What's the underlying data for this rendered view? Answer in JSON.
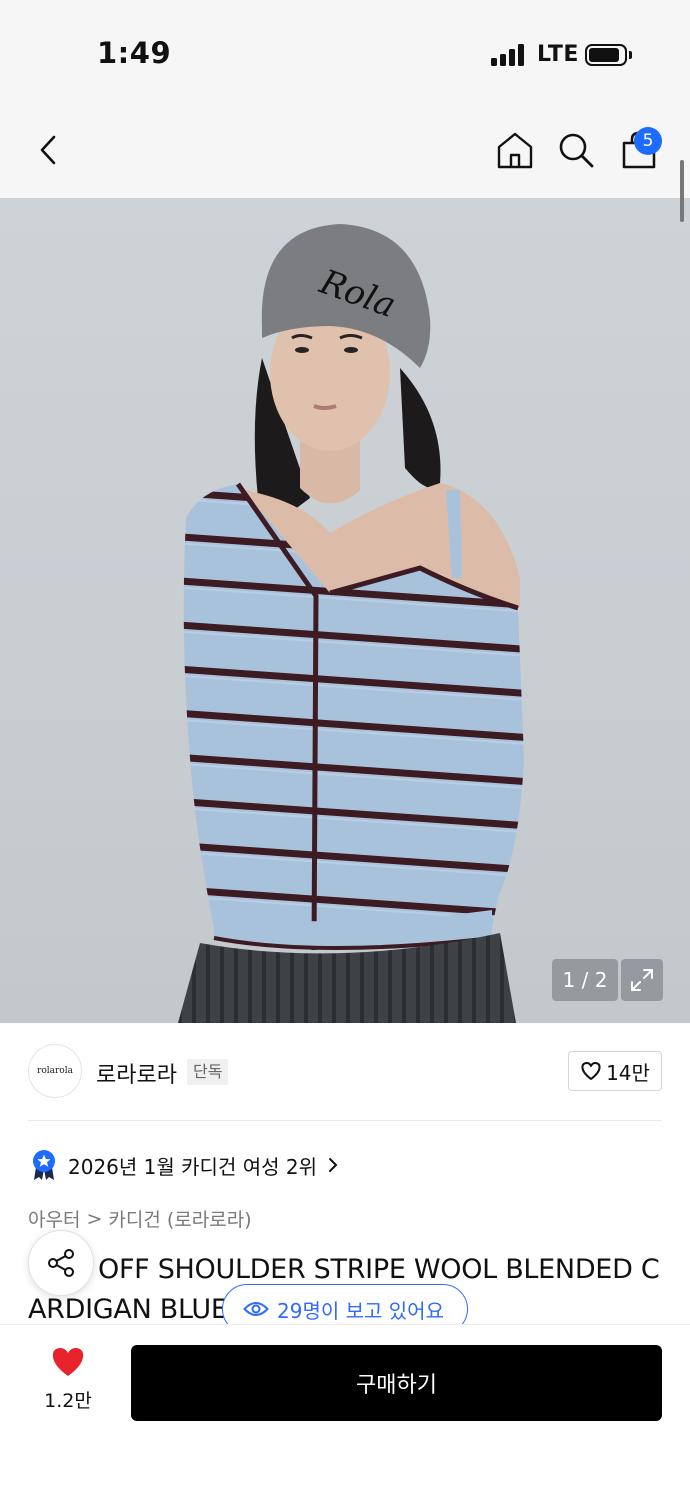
{
  "status_bar": {
    "time": "1:49",
    "network": "LTE"
  },
  "nav": {
    "back_icon": "chevron-left-icon",
    "home_icon": "home-icon",
    "search_icon": "search-icon",
    "cart_icon": "shopping-bag-icon",
    "cart_count": "5"
  },
  "gallery": {
    "page_indicator": "1 / 2",
    "expand_icon": "expand-icon",
    "thumb_arrow": "›"
  },
  "brand": {
    "logo_text": "rolarola",
    "name": "로라로라",
    "tag": "단독",
    "likes": "14만"
  },
  "ranking": {
    "text": "2026년 1월 카디건 여성 2위",
    "chevron": "›"
  },
  "category": {
    "level1": "아우터",
    "separator": ">",
    "level2": "카디건 (로라로라)"
  },
  "product": {
    "title": "OFF SHOULDER STRIPE WOOL BLENDED CARDIGAN BLUE",
    "viewers": "29명이 보고 있어요"
  },
  "bottom": {
    "heart_count": "1.2만",
    "buy_label": "구매하기"
  },
  "colors": {
    "accent_blue": "#1e6cff",
    "heart_red": "#e8232b",
    "buy_bg": "#000000"
  }
}
